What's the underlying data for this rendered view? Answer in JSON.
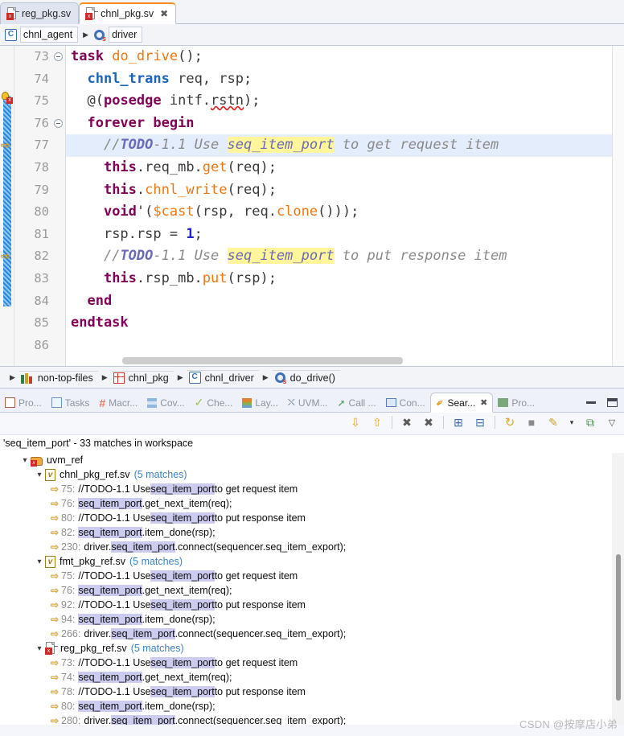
{
  "editor_tabs": [
    {
      "label": "reg_pkg.sv",
      "active": false,
      "closable": false,
      "icon": "sv-file-icon"
    },
    {
      "label": "chnl_pkg.sv",
      "active": true,
      "closable": true,
      "icon": "sv-file-icon"
    }
  ],
  "top_breadcrumb": [
    {
      "label": "chnl_agent",
      "icon": "class-icon"
    },
    {
      "label": "driver",
      "icon": "task-gear-icon"
    }
  ],
  "code": {
    "lines": [
      {
        "num": "73",
        "fold": true,
        "current": false
      },
      {
        "num": "74",
        "fold": false,
        "current": false
      },
      {
        "num": "75",
        "fold": false,
        "current": false
      },
      {
        "num": "76",
        "fold": true,
        "current": false
      },
      {
        "num": "77",
        "fold": false,
        "current": true
      },
      {
        "num": "78",
        "fold": false,
        "current": false
      },
      {
        "num": "79",
        "fold": false,
        "current": false
      },
      {
        "num": "80",
        "fold": false,
        "current": false
      },
      {
        "num": "81",
        "fold": false,
        "current": false
      },
      {
        "num": "82",
        "fold": false,
        "current": false
      },
      {
        "num": "83",
        "fold": false,
        "current": false
      },
      {
        "num": "84",
        "fold": false,
        "current": false
      },
      {
        "num": "85",
        "fold": false,
        "current": false
      },
      {
        "num": "86",
        "fold": false,
        "current": false
      }
    ],
    "text": {
      "l73": "task do_drive();",
      "l74": "chnl_trans req, rsp;",
      "l75": "@(posedge intf.rstn);",
      "l76": "forever begin",
      "l77": "//TODO-1.1 Use seq_item_port to get request item",
      "l78": "this.req_mb.get(req);",
      "l79": "this.chnl_write(req);",
      "l80": "void'($cast(rsp, req.clone()));",
      "l81": "rsp.rsp = 1;",
      "l82": "//TODO-1.1 Use seq_item_port to put response item",
      "l83": "this.rsp_mb.put(rsp);",
      "l84": "end",
      "l85": "endtask",
      "l86": ""
    },
    "highlight_token": "seq_item_port"
  },
  "bottom_breadcrumb": [
    {
      "label": "non-top-files",
      "icon": "books-icon"
    },
    {
      "label": "chnl_pkg",
      "icon": "package-grid-icon"
    },
    {
      "label": "chnl_driver",
      "icon": "class-icon"
    },
    {
      "label": "do_drive()",
      "icon": "task-gear-icon"
    }
  ],
  "view_tabs": [
    {
      "label": "Pro...",
      "icon": "problems-icon",
      "active": false,
      "closable": false
    },
    {
      "label": "Tasks",
      "icon": "tasks-icon",
      "active": false,
      "closable": false
    },
    {
      "label": "Macr...",
      "icon": "macro-icon",
      "active": false,
      "closable": false
    },
    {
      "label": "Cov...",
      "icon": "coverage-icon",
      "active": false,
      "closable": false
    },
    {
      "label": "Che...",
      "icon": "check-icon",
      "active": false,
      "closable": false
    },
    {
      "label": "Lay...",
      "icon": "layers-icon",
      "active": false,
      "closable": false
    },
    {
      "label": "UVM...",
      "icon": "hierarchy-icon",
      "active": false,
      "closable": false
    },
    {
      "label": "Call ...",
      "icon": "call-hierarchy-icon",
      "active": false,
      "closable": false
    },
    {
      "label": "Con...",
      "icon": "console-icon",
      "active": false,
      "closable": false
    },
    {
      "label": "Sear...",
      "icon": "search-icon",
      "active": true,
      "closable": true
    },
    {
      "label": "Pro...",
      "icon": "progress-icon",
      "active": false,
      "closable": false
    }
  ],
  "window_buttons": {
    "minimize": "minimize-button",
    "maximize": "maximize-button"
  },
  "search_toolbar": [
    {
      "name": "show-next-match-button",
      "glyph": "⇩"
    },
    {
      "name": "show-previous-match-button",
      "glyph": "⇧"
    },
    {
      "name": "remove-selected-matches-button",
      "glyph": "✖"
    },
    {
      "name": "remove-all-matches-button",
      "glyph": "✖"
    },
    {
      "name": "expand-all-button",
      "glyph": "⊞"
    },
    {
      "name": "collapse-all-button",
      "glyph": "⊟"
    },
    {
      "name": "run-current-search-again-button",
      "glyph": "↻"
    },
    {
      "name": "cancel-search-button",
      "glyph": "■"
    },
    {
      "name": "previous-searches-button",
      "glyph": "✎"
    },
    {
      "name": "previous-searches-dropdown",
      "glyph": "▾"
    },
    {
      "name": "pin-search-view-button",
      "glyph": "⧉"
    },
    {
      "name": "view-menu-button",
      "glyph": "▽"
    }
  ],
  "search_results": {
    "summary": "'seq_item_port' - 33 matches in workspace",
    "root": {
      "label": "uvm_ref",
      "icon": "project-folder-icon",
      "expanded": true
    },
    "files": [
      {
        "name": "chnl_pkg_ref.sv",
        "matches_label": "(5 matches)",
        "icon": "verilog-file-icon",
        "expanded": true,
        "matches": [
          {
            "line": "75:",
            "pre": "//TODO-1.1 Use ",
            "match": "seq_item_port",
            "post": " to get request item"
          },
          {
            "line": "76:",
            "pre": "",
            "match": "seq_item_port",
            "post": ".get_next_item(req);"
          },
          {
            "line": "80:",
            "pre": "//TODO-1.1 Use ",
            "match": "seq_item_port",
            "post": " to put response item"
          },
          {
            "line": "82:",
            "pre": "",
            "match": "seq_item_port",
            "post": ".item_done(rsp);"
          },
          {
            "line": "230:",
            "pre": "driver.",
            "match": "seq_item_port",
            "post": ".connect(sequencer.seq_item_export);"
          }
        ]
      },
      {
        "name": "fmt_pkg_ref.sv",
        "matches_label": "(5 matches)",
        "icon": "verilog-file-icon",
        "expanded": true,
        "matches": [
          {
            "line": "75:",
            "pre": "//TODO-1.1 Use ",
            "match": "seq_item_port",
            "post": " to get request item"
          },
          {
            "line": "76:",
            "pre": "",
            "match": "seq_item_port",
            "post": ".get_next_item(req);"
          },
          {
            "line": "92:",
            "pre": "//TODO-1.1 Use ",
            "match": "seq_item_port",
            "post": " to put response item"
          },
          {
            "line": "94:",
            "pre": "",
            "match": "seq_item_port",
            "post": ".item_done(rsp);"
          },
          {
            "line": "266:",
            "pre": "driver.",
            "match": "seq_item_port",
            "post": ".connect(sequencer.seq_item_export);"
          }
        ]
      },
      {
        "name": "reg_pkg_ref.sv",
        "matches_label": "(5 matches)",
        "icon": "sv-file-icon",
        "expanded": true,
        "matches": [
          {
            "line": "73:",
            "pre": "//TODO-1.1 Use ",
            "match": "seq_item_port",
            "post": " to get request item"
          },
          {
            "line": "74:",
            "pre": "",
            "match": "seq_item_port",
            "post": ".get_next_item(req);"
          },
          {
            "line": "78:",
            "pre": "//TODO-1.1 Use ",
            "match": "seq_item_port",
            "post": " to put response item"
          },
          {
            "line": "80:",
            "pre": "",
            "match": "seq_item_port",
            "post": ".item_done(rsp);"
          },
          {
            "line": "280:",
            "pre": "driver.",
            "match": "seq_item_port",
            "post": ".connect(sequencer.seq_item_export);"
          }
        ]
      }
    ]
  },
  "watermark": "CSDN @按摩店小弟",
  "colors": {
    "keyword": "#7f0055",
    "type": "#1a63b8",
    "function": "#ee7711",
    "comment": "#8a8a8a",
    "todo_keyword": "#6a6ab8",
    "occurrence_highlight": "#fff59a",
    "current_line": "#e4edfb",
    "match_highlight": "#ccccf0",
    "match_count": "#3b82c4",
    "accent_tab": "#ff8c1a"
  }
}
